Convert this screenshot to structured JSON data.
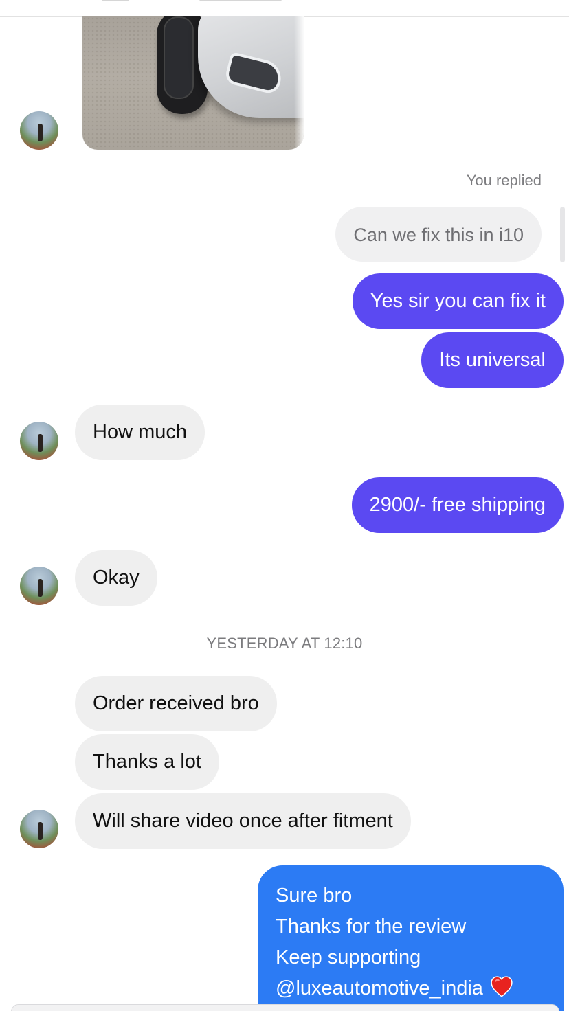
{
  "conversation": {
    "replied_label": "You replied",
    "quoted_message": "Can we fix this in i10",
    "timestamp": "YESTERDAY AT 12:10",
    "messages": [
      {
        "from": "me",
        "text": "Yes sir you can fix it"
      },
      {
        "from": "me",
        "text": "Its universal"
      },
      {
        "from": "them",
        "text": "How much"
      },
      {
        "from": "me",
        "text": "2900/- free shipping"
      },
      {
        "from": "them",
        "text": "Okay"
      },
      {
        "from": "them",
        "text": "Order received bro"
      },
      {
        "from": "them",
        "text": "Thanks a lot"
      },
      {
        "from": "them",
        "text": "Will share video once after fitment"
      }
    ],
    "last_reply": {
      "lines": [
        "Sure bro",
        "Thanks for the review",
        "Keep supporting",
        "@luxeautomotive_india"
      ],
      "emoji": "heart-icon"
    }
  },
  "theme": {
    "outgoing_purple": "#5b49f2",
    "outgoing_blue": "#2c7bf4",
    "incoming_bg": "#efefef",
    "heart_color": "#e8231f"
  }
}
